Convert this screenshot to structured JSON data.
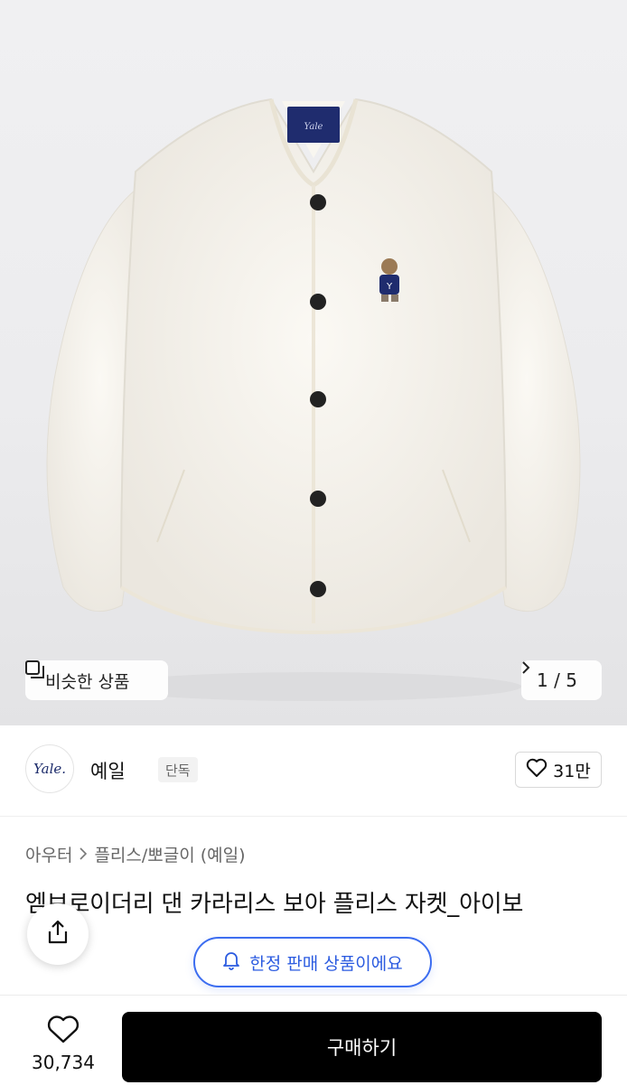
{
  "hero": {
    "image_alt": "",
    "similar_label": "비슷한 상품",
    "page_indicator": "1 / 5"
  },
  "brand": {
    "logo_text": "Yale.",
    "name": "예일",
    "badge": "단독",
    "like_count": "31만"
  },
  "product": {
    "breadcrumb": [
      "아우터",
      "플리스/뽀글이 (예일)"
    ],
    "title": "엠브로이더리 댄 카라리스 보아 플리스 자켓_아이보",
    "limited_notice": "한정 판매 상품이에요"
  },
  "bottom": {
    "wish_count": "30,734",
    "buy_label": "구매하기"
  },
  "colors": {
    "accent_blue": "#3c6df0",
    "buy_button": "#000000",
    "jacket": "#f4f1ea"
  },
  "icons": [
    "similar-icon",
    "chevron-right-icon",
    "heart-icon",
    "share-icon",
    "bell-icon"
  ]
}
